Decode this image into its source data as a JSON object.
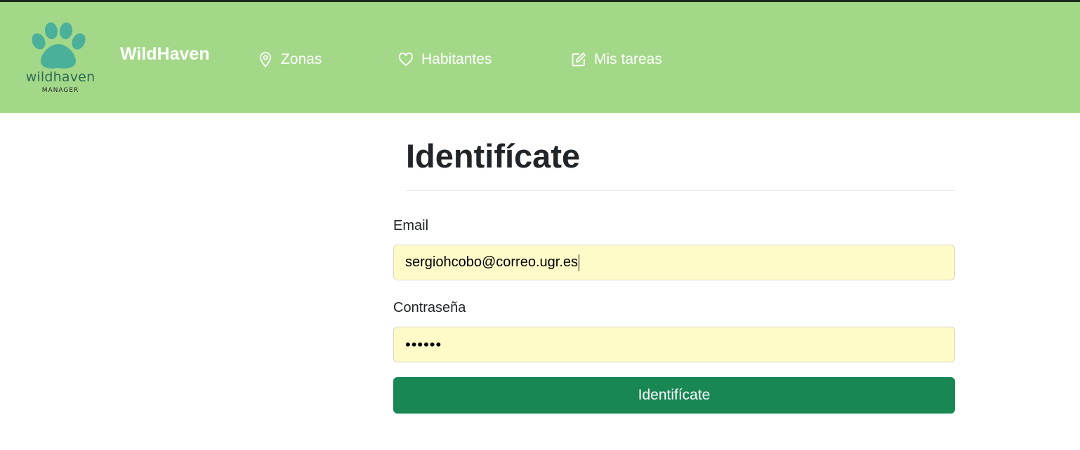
{
  "header": {
    "logo_word": "wildhaven",
    "logo_sub": "MANAGER",
    "brand": "WildHaven",
    "nav": [
      {
        "label": "Zonas",
        "icon": "map-pin-icon"
      },
      {
        "label": "Habitantes",
        "icon": "heart-icon"
      },
      {
        "label": "Mis tareas",
        "icon": "edit-square-icon"
      }
    ]
  },
  "form": {
    "title": "Identifícate",
    "email_label": "Email",
    "email_value": "sergiohcobo@correo.ugr.es",
    "password_label": "Contraseña",
    "password_value": "••••••",
    "submit_label": "Identifícate"
  },
  "colors": {
    "navbar": "#a3d888",
    "logo": "#4bb09a",
    "autofill": "#fffbc9",
    "button": "#198754"
  }
}
